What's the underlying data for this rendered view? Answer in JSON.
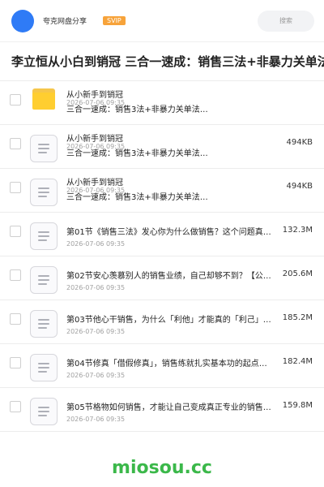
{
  "header": {
    "app_name": "夸克网盘分享",
    "badge": "SVIP",
    "search_placeholder": "搜索"
  },
  "title": "李立恒从小白到销冠 三合一速成：销售三法+非暴力关单法",
  "items": [
    {
      "name_line1": "从小新手到销冠",
      "name_line2": "三合一速成：销售3法+非暴力关单法…",
      "date": "2026-07-06 09:35",
      "size": "",
      "type": "folder"
    },
    {
      "name_line1": "从小新手到销冠",
      "name_line2": "三合一速成：销售3法+非暴力关单法…",
      "date": "2026-07-06 09:35",
      "size": "494KB",
      "type": "file"
    },
    {
      "name_line1": "从小新手到销冠",
      "name_line2": "三合一速成：销售3法+非暴力关单法…",
      "date": "2026-07-06 09:35",
      "size": "494KB",
      "type": "file"
    },
    {
      "name_line1": "第01节《销售三法》发心你为什么做销售？这个问题真…",
      "name_line2": "",
      "date": "2026-07-06 09:35",
      "size": "132.3M",
      "type": "file"
    },
    {
      "name_line1": "第02节安心羡慕别人的销售业绩，自己却够不到？【公…",
      "name_line2": "",
      "date": "2026-07-06 09:35",
      "size": "205.6M",
      "type": "file"
    },
    {
      "name_line1": "第03节他心干销售，为什么「利他」才能真的「利己」…",
      "name_line2": "",
      "date": "2026-07-06 09:35",
      "size": "185.2M",
      "type": "file"
    },
    {
      "name_line1": "第04节修真「借假修真」，销售练就扎实基本功的起点…",
      "name_line2": "",
      "date": "2026-07-06 09:35",
      "size": "182.4M",
      "type": "file"
    },
    {
      "name_line1": "第05节格物如何销售，才能让自己变成真正专业的销售…",
      "name_line2": "",
      "date": "2026-07-06 09:35",
      "size": "159.8M",
      "type": "file"
    }
  ],
  "footer": {
    "watermark": "miosou.cc"
  },
  "colors": {
    "accent": "#2f7bf6",
    "svip": "#f7a33a",
    "folder": "#ffce30",
    "watermark": "#3bb84a"
  }
}
